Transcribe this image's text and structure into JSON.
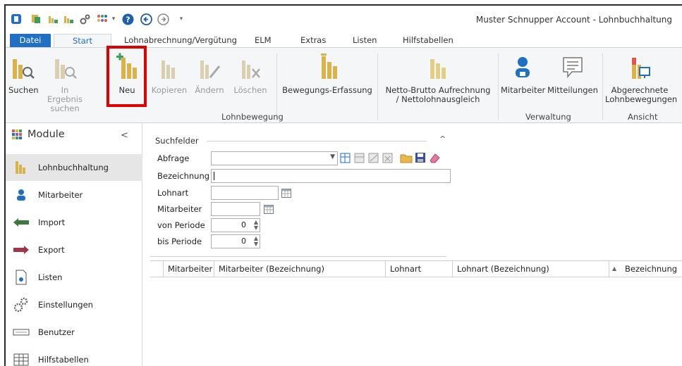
{
  "window": {
    "title": "Muster Schnupper Account - Lohnbuchhaltung"
  },
  "quick_access": [
    "app-icon",
    "copy-icon",
    "chart-icon-1",
    "chart-icon-2",
    "gears-icon",
    "grid-dots-icon",
    "dropdown-arrow-icon",
    "help-icon",
    "back-icon",
    "forward-icon",
    "customize-icon"
  ],
  "tabs": {
    "datei": "Datei",
    "start": "Start",
    "lohnabrechnung": "Lohnabrechnung/Vergütung",
    "elm": "ELM",
    "extras": "Extras",
    "listen": "Listen",
    "hilfstabellen": "Hilfstabellen"
  },
  "ribbon": {
    "suchen": "Suchen",
    "in_ergebnis_1": "In Ergebnis",
    "in_ergebnis_2": "suchen",
    "neu": "Neu",
    "kopieren": "Kopieren",
    "aendern": "Ändern",
    "loeschen": "Löschen",
    "bewegungs": "Bewegungs-Erfassung",
    "netto_1": "Netto-Brutto Aufrechnung",
    "netto_2": "/ Nettolohnausgleich",
    "mitarbeiter": "Mitarbeiter",
    "mitteilungen": "Mitteilungen",
    "abger_1": "Abgerechnete",
    "abger_2": "Lohnbewegungen",
    "group_lohnbewegung": "Lohnbewegung",
    "group_verwaltung": "Verwaltung",
    "group_ansicht": "Ansicht"
  },
  "colors": {
    "accent": "#1f6fc5",
    "highlight": "#e00000",
    "icon_gold": "#d9b24a",
    "icon_green": "#3b9e5a"
  },
  "module_panel": {
    "title": "Module",
    "collapse": "<",
    "items": [
      {
        "label": "Lohnbuchhaltung",
        "icon": "lohn-icon",
        "active": true
      },
      {
        "label": "Mitarbeiter",
        "icon": "user-icon",
        "active": false
      },
      {
        "label": "Import",
        "icon": "import-arrow-icon",
        "active": false
      },
      {
        "label": "Export",
        "icon": "export-arrow-icon",
        "active": false
      },
      {
        "label": "Listen",
        "icon": "list-doc-icon",
        "active": false
      },
      {
        "label": "Einstellungen",
        "icon": "gears-icon",
        "active": false
      },
      {
        "label": "Benutzer",
        "icon": "keyboard-icon",
        "active": false
      },
      {
        "label": "Hilfstabellen",
        "icon": "table-icon",
        "active": false
      }
    ]
  },
  "search": {
    "legend": "Suchfelder",
    "caret": "^",
    "abfrage_label": "Abfrage",
    "bezeichnung_label": "Bezeichnung",
    "lohnart_label": "Lohnart",
    "mitarbeiter_label": "Mitarbeiter",
    "von_periode_label": "von Periode",
    "von_periode_value": "0",
    "bis_periode_label": "bis Periode",
    "bis_periode_value": "0"
  },
  "grid": {
    "columns": [
      "Mitarbeiter",
      "Mitarbeiter (Bezeichnung)",
      "Lohnart",
      "Lohnart (Bezeichnung)",
      "Bezeichnung"
    ],
    "sort_glyph": "▲"
  }
}
